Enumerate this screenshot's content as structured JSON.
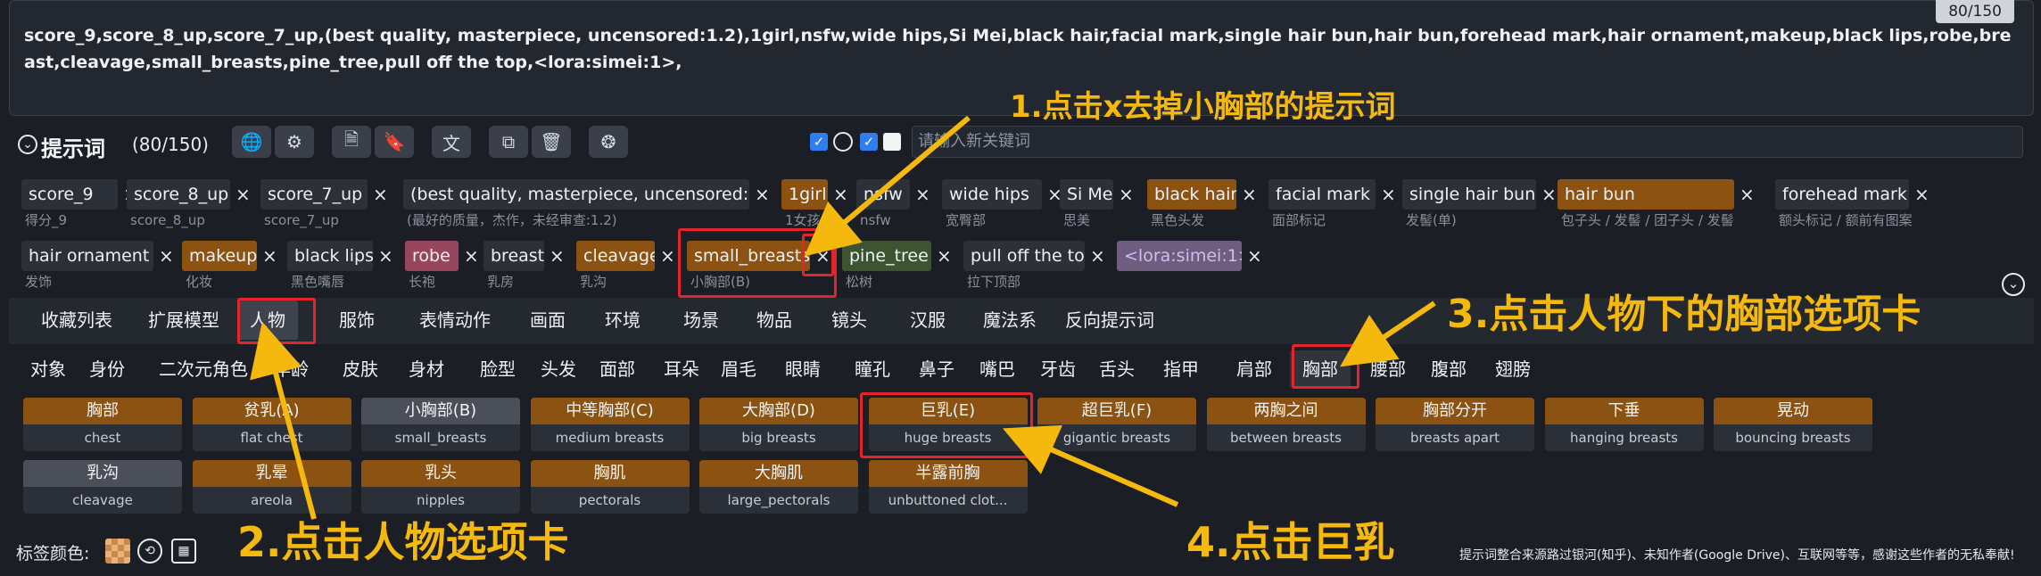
{
  "prompt": {
    "text": "score_9,score_8_up,score_7_up,(best quality, masterpiece, uncensored:1.2),1girl,nsfw,wide hips,Si Mei,black hair,facial mark,single hair bun,hair bun,forehead mark,hair ornament,makeup,black lips,robe,breast,cleavage,small_breasts,pine_tree,pull off the top,<lora:simei:1>,",
    "counter": "80/150"
  },
  "toolbar": {
    "title": "提示词",
    "count": "(80/150)",
    "keyword_placeholder": "请输入新关键词",
    "icons": [
      "globe-icon",
      "gear-icon",
      "doc-settings-icon",
      "bookmark-icon",
      "translate-icon",
      "copy-icon",
      "trash-icon",
      "openai-icon"
    ]
  },
  "tags_row1": [
    {
      "label": "score_9",
      "sub": "得分_9",
      "style": "plain"
    },
    {
      "label": "score_8_up",
      "sub": "score_8_up",
      "style": "plain"
    },
    {
      "label": "score_7_up",
      "sub": "score_7_up",
      "style": "plain"
    },
    {
      "label": "(best quality, masterpiece, uncensored:1.2)",
      "sub": "(最好的质量，杰作，未经审查:1.2)",
      "style": "plain"
    },
    {
      "label": "1girl",
      "sub": "1女孩",
      "style": "orange"
    },
    {
      "label": "nsfw",
      "sub": "nsfw",
      "style": "plain"
    },
    {
      "label": "wide hips",
      "sub": "宽臀部",
      "style": "plain"
    },
    {
      "label": "Si Mei",
      "sub": "思美",
      "style": "plain"
    },
    {
      "label": "black hair",
      "sub": "黑色头发",
      "style": "orange"
    },
    {
      "label": "facial mark",
      "sub": "面部标记",
      "style": "plain"
    },
    {
      "label": "single hair bun",
      "sub": "发髻(单)",
      "style": "plain"
    },
    {
      "label": "hair bun",
      "sub": "包子头 / 发髻 / 团子头 / 发髻",
      "style": "orange"
    },
    {
      "label": "forehead mark",
      "sub": "额头标记 / 额前有图案",
      "style": "plain"
    }
  ],
  "tags_row2": [
    {
      "label": "hair ornament",
      "sub": "发饰",
      "style": "plain"
    },
    {
      "label": "makeup",
      "sub": "化妆",
      "style": "orange"
    },
    {
      "label": "black lips",
      "sub": "黑色嘴唇",
      "style": "plain"
    },
    {
      "label": "robe",
      "sub": "长袍",
      "style": "pink"
    },
    {
      "label": "breast",
      "sub": "乳房",
      "style": "plain"
    },
    {
      "label": "cleavage",
      "sub": "乳沟",
      "style": "orange"
    },
    {
      "label": "small_breasts",
      "sub": "小胸部(B)",
      "style": "orange"
    },
    {
      "label": "pine_tree",
      "sub": "松树",
      "style": "green"
    },
    {
      "label": "pull off the top",
      "sub": "拉下顶部",
      "style": "plain"
    },
    {
      "label": "<lora:simei:1>",
      "sub": "",
      "style": "lav"
    }
  ],
  "tabs": [
    "收藏列表",
    "扩展模型",
    "人物",
    "服饰",
    "表情动作",
    "画面",
    "环境",
    "场景",
    "物品",
    "镜头",
    "汉服",
    "魔法系",
    "反向提示词"
  ],
  "active_tab": "人物",
  "categories": [
    "对象",
    "身份",
    "二次元角色",
    "年龄",
    "皮肤",
    "身材",
    "脸型",
    "头发",
    "面部",
    "耳朵",
    "眉毛",
    "眼睛",
    "瞳孔",
    "鼻子",
    "嘴巴",
    "牙齿",
    "舌头",
    "指甲",
    "肩部",
    "胸部",
    "腰部",
    "腹部",
    "翅膀"
  ],
  "active_category": "胸部",
  "cards_row1": [
    {
      "zh": "胸部",
      "en": "chest",
      "style": "orange"
    },
    {
      "zh": "贫乳(A)",
      "en": "flat chest",
      "style": "orange"
    },
    {
      "zh": "小胸部(B)",
      "en": "small_breasts",
      "style": "gray"
    },
    {
      "zh": "中等胸部(C)",
      "en": "medium breasts",
      "style": "orange"
    },
    {
      "zh": "大胸部(D)",
      "en": "big breasts",
      "style": "orange"
    },
    {
      "zh": "巨乳(E)",
      "en": "huge breasts",
      "style": "orange"
    },
    {
      "zh": "超巨乳(F)",
      "en": "gigantic breasts",
      "style": "orange"
    },
    {
      "zh": "两胸之间",
      "en": "between breasts",
      "style": "orange"
    },
    {
      "zh": "胸部分开",
      "en": "breasts apart",
      "style": "orange"
    },
    {
      "zh": "下垂",
      "en": "hanging breasts",
      "style": "orange"
    },
    {
      "zh": "晃动",
      "en": "bouncing breasts",
      "style": "orange"
    }
  ],
  "cards_row2": [
    {
      "zh": "乳沟",
      "en": "cleavage",
      "style": "gray"
    },
    {
      "zh": "乳晕",
      "en": "areola",
      "style": "orange"
    },
    {
      "zh": "乳头",
      "en": "nipples",
      "style": "orange"
    },
    {
      "zh": "胸肌",
      "en": "pectorals",
      "style": "orange"
    },
    {
      "zh": "大胸肌",
      "en": "large_pectorals",
      "style": "orange"
    },
    {
      "zh": "半露前胸",
      "en": "unbuttoned clot...",
      "style": "orange"
    }
  ],
  "footer": {
    "tag_color_label": "标签颜色:",
    "credits": "提示词整合来源路过银河(知乎)、未知作者(Google Drive)、互联网等等，感谢这些作者的无私奉献!"
  },
  "annotations": {
    "a1": "1.点击x去掉小胸部的提示词",
    "a2": "2.点击人物选项卡",
    "a3": "3.点击人物下的胸部选项卡",
    "a4": "4.点击巨乳"
  },
  "colors": {
    "accent": "#f5b80c",
    "highlight": "#e3242b",
    "tag_orange": "#8c5211"
  }
}
